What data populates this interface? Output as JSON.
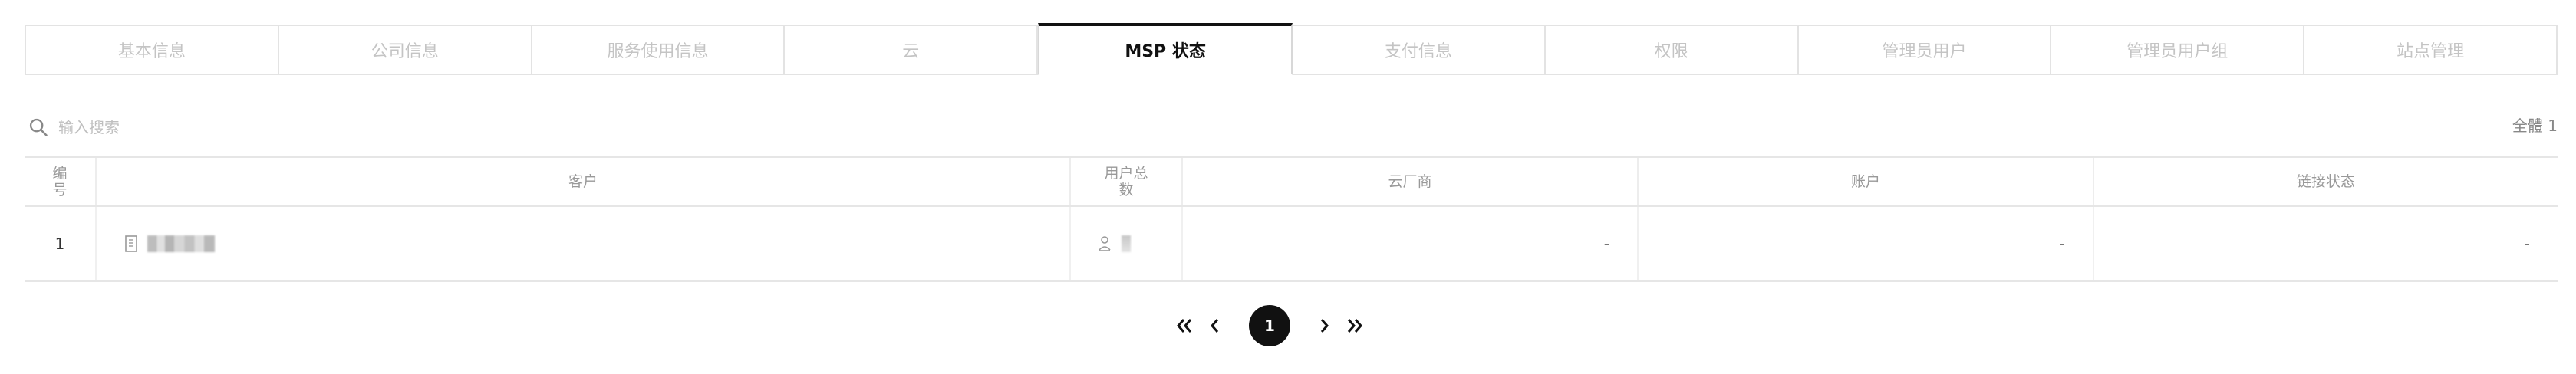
{
  "tabs": [
    {
      "label": "基本信息",
      "active": false
    },
    {
      "label": "公司信息",
      "active": false
    },
    {
      "label": "服务使用信息",
      "active": false
    },
    {
      "label": "云",
      "active": false
    },
    {
      "label": "MSP 状态",
      "active": true
    },
    {
      "label": "支付信息",
      "active": false
    },
    {
      "label": "权限",
      "active": false
    },
    {
      "label": "管理员用户",
      "active": false
    },
    {
      "label": "管理员用户组",
      "active": false
    },
    {
      "label": "站点管理",
      "active": false
    }
  ],
  "search": {
    "placeholder": "输入搜索"
  },
  "total": "全體 1",
  "table": {
    "headers": {
      "number": "编号",
      "customer": "客户",
      "user_count": "用户总数",
      "cloud_vendor": "云厂商",
      "account": "账户",
      "link_status": "链接状态"
    },
    "rows": [
      {
        "number": "1",
        "cloud_vendor": "-",
        "account": "-",
        "link_status": "-"
      }
    ]
  },
  "pagination": {
    "current": "1"
  },
  "colors": {
    "accent": "#111111",
    "muted": "#c4c4c4",
    "border": "#e3e3e3"
  }
}
